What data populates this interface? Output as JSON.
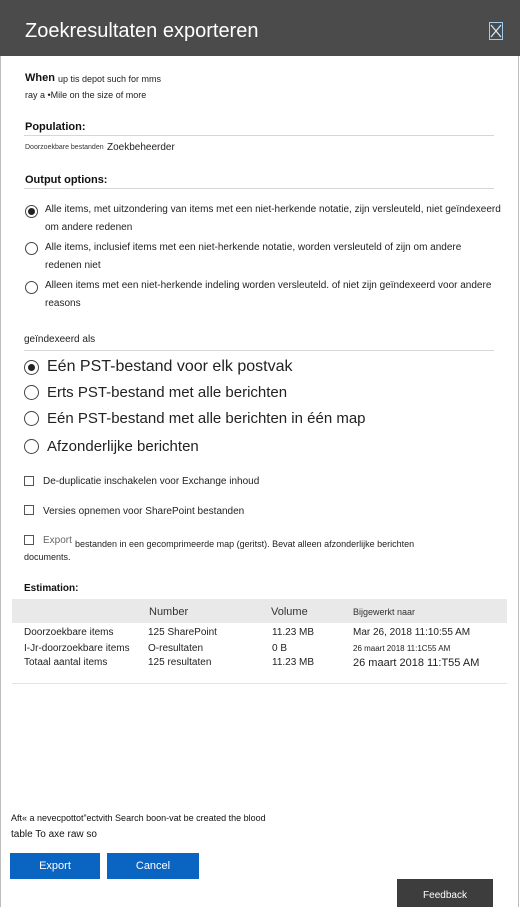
{
  "dialog": {
    "title": "Zoekresultaten exporteren",
    "close_icon": "close-icon"
  },
  "when": {
    "label": "When",
    "line1": "up tis depot such for mms",
    "line2": "ray a •Mile on the size of more"
  },
  "population": {
    "label": "Population:",
    "tiny_label": "Doorzoekbare bestanden",
    "value": "Zoekbeheerder"
  },
  "output_options": {
    "label": "Output options:",
    "options": [
      {
        "line1": "Alle items, met uitzondering van items met een niet-herkende notatie, zijn versleuteld, niet geïndexeerd",
        "line2": "om andere redenen",
        "checked": true
      },
      {
        "line1": "Alle items, inclusief items met een niet-herkende notatie, worden versleuteld of zijn om andere",
        "line2": "redenen niet",
        "checked": false
      },
      {
        "line1": "Alleen items met een niet-herkende indeling worden versleuteld. of niet zijn geïndexeerd voor andere",
        "line2": "reasons",
        "checked": false
      }
    ]
  },
  "export_as": {
    "label": "geïndexeerd als",
    "options": [
      {
        "label": "Eén PST-bestand voor elk postvak",
        "checked": true
      },
      {
        "label": "Erts PST-bestand met alle berichten",
        "checked": false
      },
      {
        "label": "Eén PST-bestand met alle berichten in één map",
        "checked": false
      },
      {
        "label": "Afzonderlijke berichten",
        "checked": false
      }
    ]
  },
  "checkboxes": {
    "dedup": "De-duplicatie inschakelen voor Exchange inhoud",
    "versions": "Versies opnemen voor SharePoint bestanden",
    "zip_prefix": "Export",
    "zip_line1": "bestanden in een gecomprimeerde map (geritst). Bevat alleen afzonderlijke berichten",
    "zip_line2": "documents."
  },
  "estimation": {
    "label": "Estimation:",
    "headers": [
      "Number",
      "Volume",
      "Bijgewerkt naar"
    ],
    "rows": [
      {
        "name": "Doorzoekbare items",
        "number": "125 SharePoint",
        "volume": "11.23 MB",
        "updated": "Mar 26, 2018 11:10:55 AM"
      },
      {
        "name": "I-Jr-doorzoekbare items",
        "number": "O-resultaten",
        "volume": "0 B",
        "updated": "26 maart 2018 11:1C55 AM"
      },
      {
        "name": "Totaal aantal items",
        "number": "125 resultaten",
        "volume": "11.23 MB",
        "updated": "26 maart 2018 11:T55 AM"
      }
    ]
  },
  "footer": {
    "note_line1": "Aft« a nevecpottot”ectvith Search boon-vat be created the blood",
    "note_line2": "table To axe raw so",
    "export_label": "Export",
    "cancel_label": "Cancel",
    "feedback_label": "Feedback"
  },
  "colors": {
    "header_bg": "#4b4b4b",
    "primary_button": "#0a65c2",
    "feedback_bg": "#3d3d3d"
  }
}
